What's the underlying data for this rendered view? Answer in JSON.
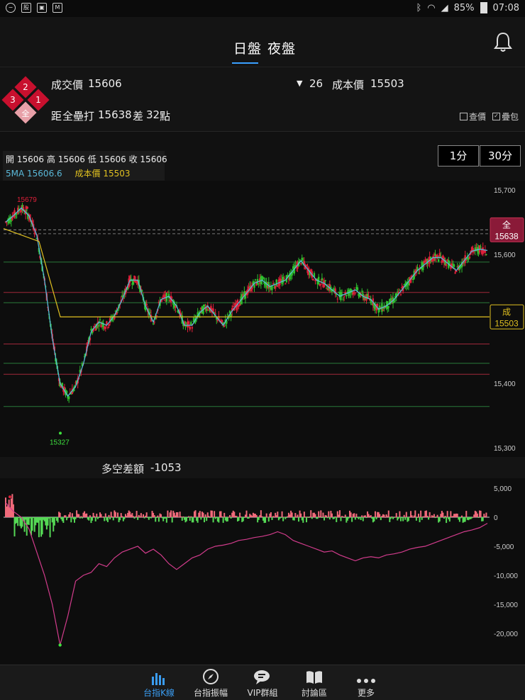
{
  "status_bar": {
    "battery": "85%",
    "time": "07:08"
  },
  "header": {
    "tabs": [
      "日盤",
      "夜盤"
    ],
    "active_tab": 0
  },
  "info": {
    "level_badges": [
      "2",
      "3",
      "1",
      "全"
    ],
    "price_label": "成交價",
    "price_value": "15606",
    "change_value": "26",
    "cost_label": "成本價",
    "cost_value": "15503",
    "distance_prefix": "距",
    "distance_target_label": "全壘打",
    "distance_target_value": "15638",
    "distance_diff_label": "差",
    "distance_diff_value": "32",
    "distance_unit": "點",
    "option_check_price": "查價",
    "option_overlay": "疊包"
  },
  "ohlc": {
    "open_label": "開",
    "open": "15606",
    "high_label": "高",
    "high": "15606",
    "low_label": "低",
    "low": "15606",
    "close_label": "收",
    "close": "15606",
    "ma_label": "5MA",
    "ma_value": "15606.6",
    "cost_label": "成本價",
    "cost_value": "15503"
  },
  "intervals": [
    "1分",
    "30分"
  ],
  "colors": {
    "up": "#e0203a",
    "down": "#2ec02e",
    "ma": "#5ab8d8",
    "cost": "#e0c020",
    "diff": "#d23c8c",
    "accent": "#3a9cf0"
  },
  "chart_data": [
    {
      "type": "candlestick",
      "y_ticks": [
        "15,700",
        "15,600",
        "15,400",
        "15,300"
      ],
      "ylim": [
        15290,
        15720
      ],
      "high_marker": "15679",
      "low_marker": "15327",
      "tags": [
        {
          "label": "全",
          "value": "15638"
        },
        {
          "label": "成",
          "value": "15503"
        }
      ],
      "ma_series": [
        15650,
        15660,
        15672,
        15660,
        15630,
        15560,
        15470,
        15400,
        15380,
        15395,
        15430,
        15480,
        15495,
        15490,
        15505,
        15530,
        15560,
        15560,
        15520,
        15495,
        15530,
        15535,
        15520,
        15490,
        15490,
        15510,
        15520,
        15505,
        15490,
        15510,
        15525,
        15540,
        15555,
        15560,
        15550,
        15555,
        15560,
        15575,
        15590,
        15575,
        15560,
        15555,
        15545,
        15535,
        15540,
        15545,
        15535,
        15530,
        15515,
        15520,
        15530,
        15545,
        15560,
        15575,
        15585,
        15595,
        15595,
        15585,
        15575,
        15590,
        15605,
        15608,
        15606
      ],
      "cost_line": 15503,
      "ref_lines": [
        15638,
        15632,
        15588,
        15541,
        15525,
        15461,
        15431,
        15414,
        15364
      ]
    },
    {
      "type": "bar+line",
      "title": "多空差額",
      "value": "-1053",
      "y_ticks": [
        "5,000",
        "0",
        "-5,000",
        "-10,000",
        "-15,000",
        "-20,000"
      ],
      "ylim": [
        -23000,
        6000
      ],
      "line_series": [
        2500,
        1000,
        0,
        -2000,
        -6000,
        -10000,
        -15000,
        -22000,
        -17000,
        -11000,
        -10000,
        -9500,
        -8000,
        -8500,
        -7000,
        -6000,
        -5500,
        -5000,
        -6200,
        -5500,
        -6500,
        -8000,
        -9000,
        -8000,
        -7000,
        -6500,
        -5500,
        -5000,
        -4800,
        -4500,
        -4000,
        -3800,
        -3500,
        -3300,
        -3000,
        -2500,
        -3000,
        -4000,
        -4500,
        -5000,
        -5500,
        -6000,
        -5800,
        -6500,
        -7000,
        -7500,
        -7000,
        -6800,
        -7000,
        -6500,
        -6300,
        -6000,
        -5500,
        -5200,
        -5000,
        -4500,
        -4000,
        -3500,
        -3000,
        -2500,
        -2200,
        -1800,
        -1053
      ],
      "marker": "-22000"
    }
  ],
  "bottom_nav": [
    {
      "label": "台指K線",
      "icon": "bar-chart-icon"
    },
    {
      "label": "台指振幅",
      "icon": "compass-icon"
    },
    {
      "label": "VIP群組",
      "icon": "chat-bubble-icon"
    },
    {
      "label": "討論區",
      "icon": "book-icon"
    },
    {
      "label": "更多",
      "icon": "more-dots-icon"
    }
  ]
}
